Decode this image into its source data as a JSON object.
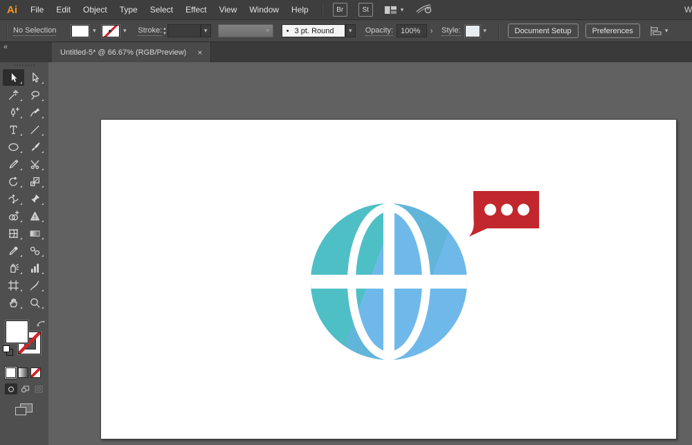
{
  "glyphs": {
    "collapse": "«",
    "chevron_down": "▾",
    "stepper_up": "▴",
    "stepper_down": "▾",
    "close": "×",
    "bullet": "•",
    "arrow_right": "›"
  },
  "menu_bar": {
    "logo_text": "Ai",
    "items": [
      "File",
      "Edit",
      "Object",
      "Type",
      "Select",
      "Effect",
      "View",
      "Window",
      "Help"
    ],
    "bridge_button": "Br",
    "stock_button": "St",
    "truncated_text": "W"
  },
  "control_bar": {
    "selection_status": "No Selection",
    "stroke_label": "Stroke:",
    "brush_preset_value": "3 pt. Round",
    "opacity_label": "Opacity:",
    "opacity_value": "100%",
    "style_label": "Style:",
    "document_setup_label": "Document Setup",
    "preferences_label": "Preferences"
  },
  "document_tab": {
    "title": "Untitled-5* @ 66.67% (RGB/Preview)"
  },
  "tools_panel": {
    "tools": [
      {
        "name": "selection-tool",
        "selected": true
      },
      {
        "name": "direct-selection-tool"
      },
      {
        "name": "magic-wand-tool"
      },
      {
        "name": "lasso-tool"
      },
      {
        "name": "pen-tool"
      },
      {
        "name": "curvature-tool"
      },
      {
        "name": "type-tool"
      },
      {
        "name": "line-segment-tool"
      },
      {
        "name": "ellipse-tool"
      },
      {
        "name": "paintbrush-tool"
      },
      {
        "name": "pencil-tool"
      },
      {
        "name": "scissors-tool"
      },
      {
        "name": "rotate-tool"
      },
      {
        "name": "scale-tool"
      },
      {
        "name": "width-tool"
      },
      {
        "name": "free-transform-tool"
      },
      {
        "name": "shape-builder-tool"
      },
      {
        "name": "perspective-grid-tool"
      },
      {
        "name": "mesh-tool"
      },
      {
        "name": "gradient-tool"
      },
      {
        "name": "eyedropper-tool"
      },
      {
        "name": "blend-tool"
      },
      {
        "name": "symbol-sprayer-tool"
      },
      {
        "name": "column-graph-tool"
      },
      {
        "name": "artboard-tool"
      },
      {
        "name": "slice-tool"
      },
      {
        "name": "hand-tool"
      },
      {
        "name": "zoom-tool"
      }
    ]
  },
  "colors": {
    "ui_menubar": "#3E3E3E",
    "ui_controlbar": "#474747",
    "ui_tabstrip": "#3A3A3A",
    "ui_panel": "#4F4F4F",
    "ui_canvas": "#616161",
    "artboard": "#FFFFFF"
  },
  "logo": {
    "teal": "#4FBFC6",
    "blue": "#6FB9EA",
    "teal_blue_blend": "#61B5D9",
    "bubble_red": "#C1272D",
    "dots": "#FFFFFF"
  }
}
